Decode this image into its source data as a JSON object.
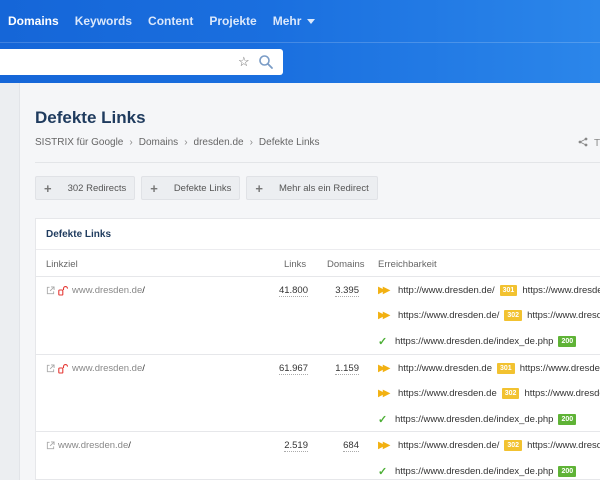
{
  "nav": {
    "items": [
      "Domains",
      "Keywords",
      "Content",
      "Projekte",
      "Mehr"
    ]
  },
  "search": {
    "value": "",
    "placeholder": ""
  },
  "page": {
    "title": "Defekte Links",
    "breadcrumb": [
      "SISTRIX für Google",
      "Domains",
      "dresden.de",
      "Defekte Links"
    ],
    "share_label": "T"
  },
  "filters": [
    "302 Redirects",
    "Defekte Links",
    "Mehr als ein Redirect"
  ],
  "table": {
    "title": "Defekte Links",
    "headers": {
      "linkziel": "Linkziel",
      "links": "Links",
      "domains": "Domains",
      "erreichbarkeit": "Erreichbarkeit"
    },
    "rows": [
      {
        "target": "www.dresden.de",
        "slash": "/",
        "links": "41.800",
        "domains": "3.395",
        "hops": [
          {
            "url": "http://www.dresden.de/",
            "code": "301",
            "next": "https://www.dresden.d"
          },
          {
            "url": "https://www.dresden.de/",
            "code": "302",
            "next": "https://www.dresden."
          },
          {
            "url": "https://www.dresden.de/index_de.php",
            "code": "200",
            "next": ""
          }
        ]
      },
      {
        "target": "www.dresden.de",
        "slash": "/",
        "links": "61.967",
        "domains": "1.159",
        "hops": [
          {
            "url": "http://www.dresden.de",
            "code": "301",
            "next": "https://www.dresden.d"
          },
          {
            "url": "https://www.dresden.de",
            "code": "302",
            "next": "https://www.dresden."
          },
          {
            "url": "https://www.dresden.de/index_de.php",
            "code": "200",
            "next": ""
          }
        ]
      },
      {
        "target": "www.dresden.de",
        "slash": "/",
        "links": "2.519",
        "domains": "684",
        "hops": [
          {
            "url": "https://www.dresden.de/",
            "code": "302",
            "next": "https://www.dresden."
          },
          {
            "url": "https://www.dresden.de/index_de.php",
            "code": "200",
            "next": ""
          }
        ]
      }
    ]
  },
  "colors": {
    "header": "#1566d8",
    "title": "#1f3b5e",
    "redirect": "#f2c230",
    "ok": "#5fb336",
    "broken": "#e53935"
  }
}
